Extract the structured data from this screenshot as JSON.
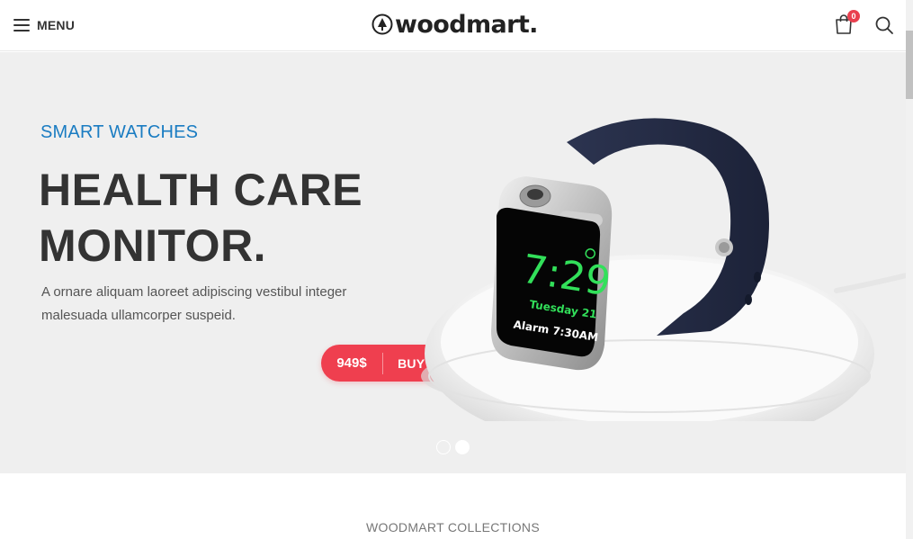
{
  "header": {
    "menu_label": "MENU",
    "logo_text": "woodmart.",
    "cart_count": "0",
    "icons": [
      "hamburger-icon",
      "logo-mark-icon",
      "shopping-bag-icon",
      "search-icon"
    ]
  },
  "hero": {
    "eyebrow": "SMART WATCHES",
    "headline_line1": "HEALTH CARE",
    "headline_line2": "MONITOR.",
    "description": "A ornare aliquam laoreet adipiscing vestibul integer malesuada ullamcorper suspeid.",
    "price": "949$",
    "button_label": "BUY NOW",
    "watch_face": {
      "time": "7:29",
      "date": "Tuesday 21",
      "alarm": "Alarm 7:30AM"
    },
    "slider": {
      "slides": 2,
      "active_index": 1
    }
  },
  "section": {
    "title": "WOODMART COLLECTIONS"
  },
  "colors": {
    "accent_blue": "#1a7cc2",
    "button_red": "#ef3f4f",
    "hero_bg": "#efefef",
    "badge_red": "#e9404f"
  }
}
